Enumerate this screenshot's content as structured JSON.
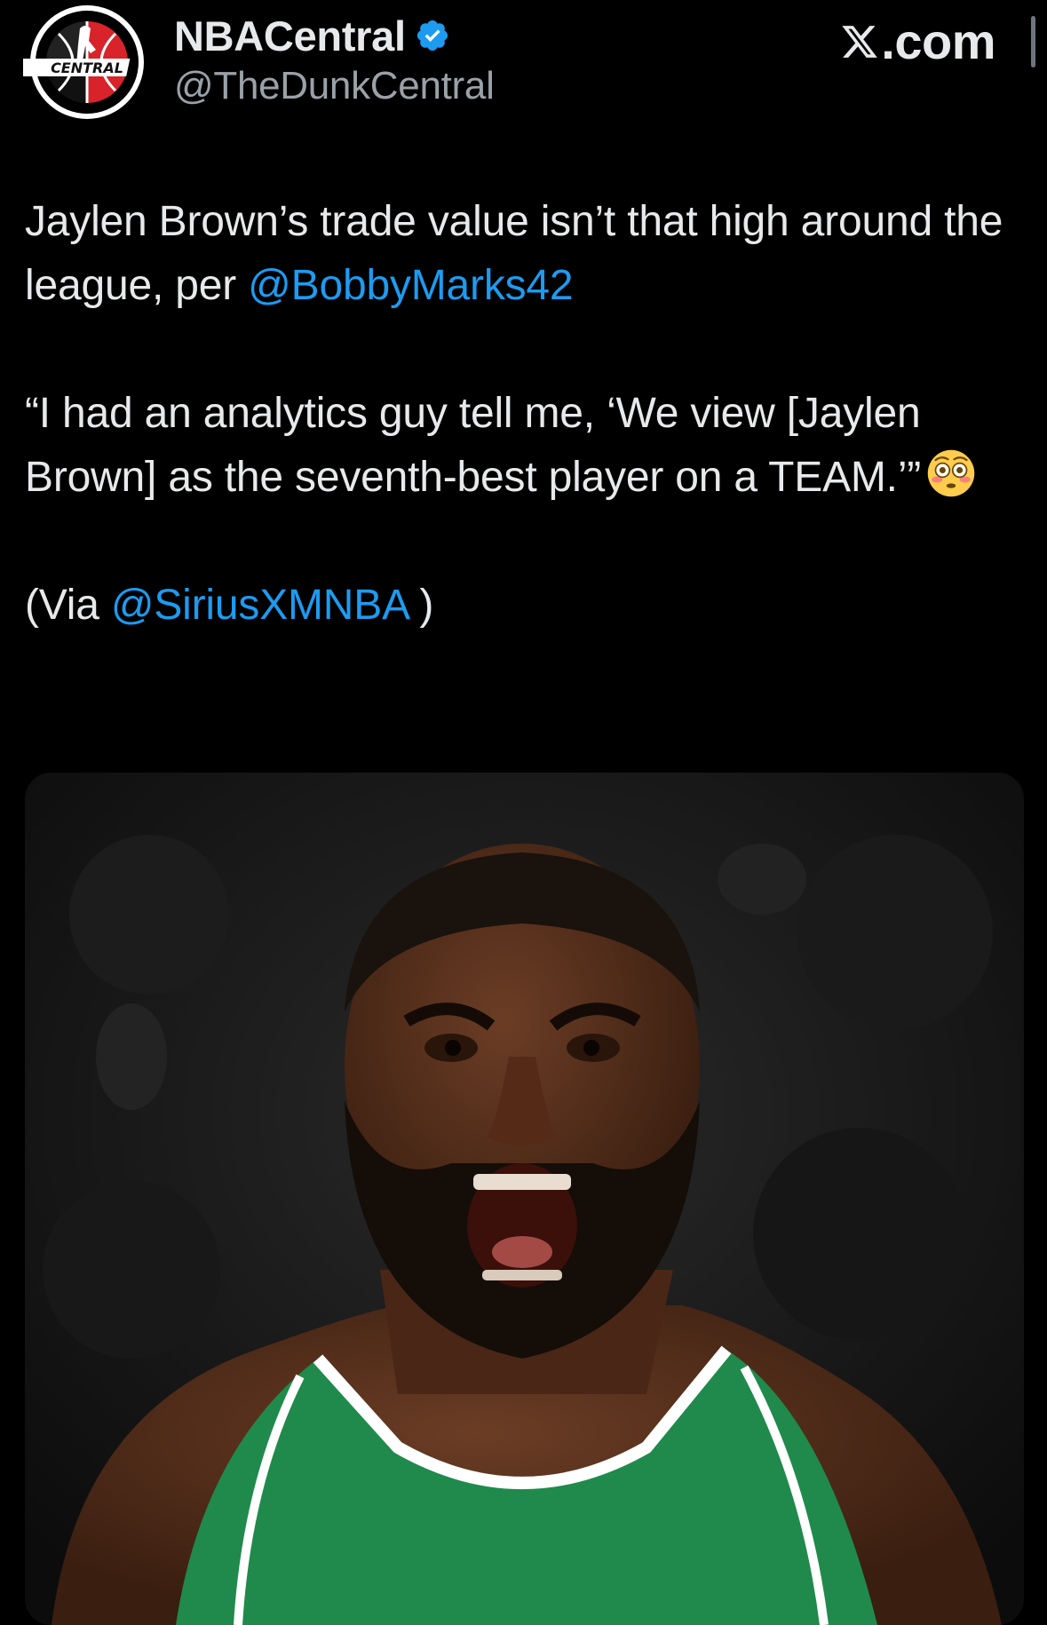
{
  "header": {
    "display_name": "NBACentral",
    "handle": "@TheDunkCentral",
    "avatar_logo_text": "CENTRAL",
    "brand": ".com",
    "verified": true
  },
  "tweet": {
    "p1_text": "Jaylen Brown’s trade value isn’t that high around the league, per ",
    "p1_mention": "@BobbyMarks42",
    "p2_text": "“I had an analytics guy tell me, ‘We view [Jaylen Brown] as the seventh-best player on a TEAM.’”",
    "p2_emoji": "flushed-face",
    "p3_prefix": "(Via ",
    "p3_mention": "@SiriusXMNBA",
    "p3_suffix": " )"
  },
  "colors": {
    "background": "#000000",
    "text": "#e7e9ea",
    "secondary_text": "#9aa1a8",
    "link": "#1d9bf0",
    "verified_badge": "#1d9bf0",
    "jersey_green": "#1f8a4c"
  }
}
